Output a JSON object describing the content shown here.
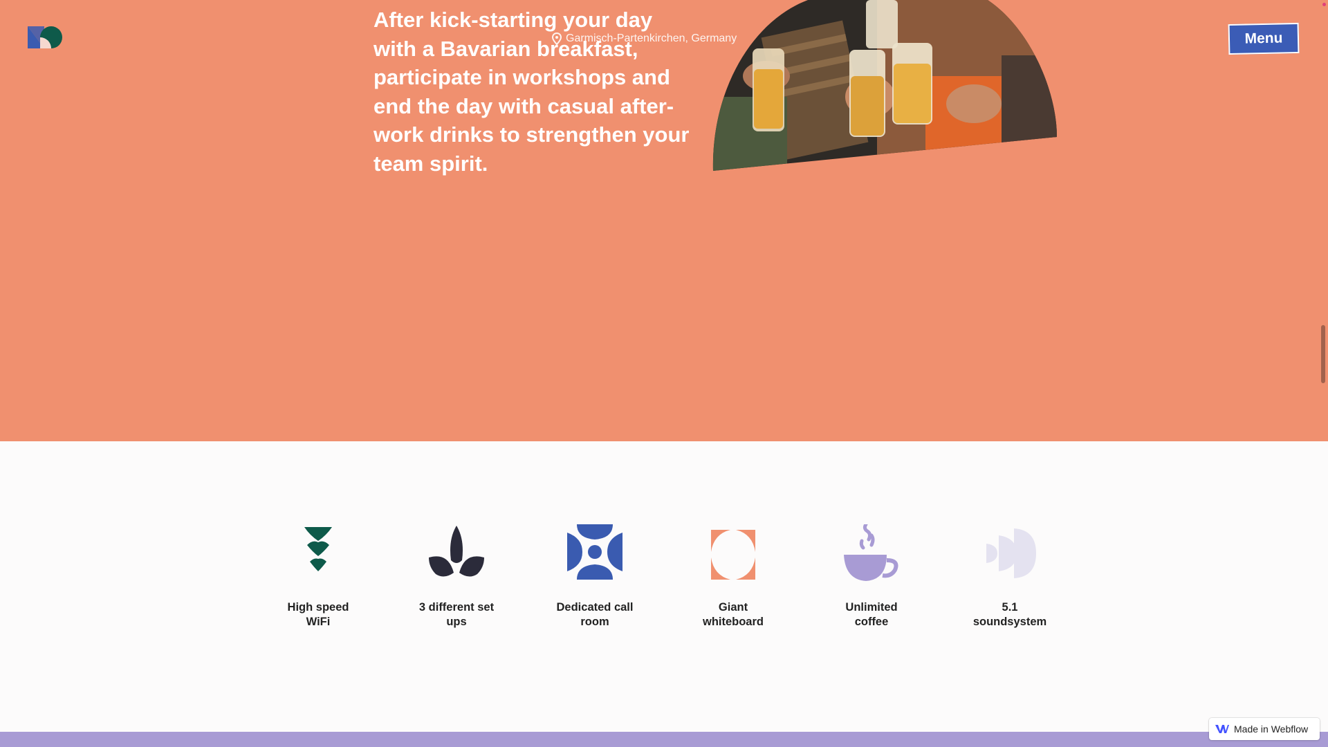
{
  "header": {
    "logo_icon": "brand-logo-icon",
    "menu_label": "Menu"
  },
  "hero": {
    "text": "After kick-starting your day with a Bavarian breakfast, participate in workshops and end the day with casual after-work drinks to strengthen your team spirit.",
    "location": "Garmisch-Partenkirchen, Germany",
    "location_icon": "map-pin-icon",
    "background_color": "#f0906f"
  },
  "amenities": [
    {
      "label": "High speed WiFi",
      "icon": "wifi-icon",
      "color": "#0e5a4a"
    },
    {
      "label": "3 different set ups",
      "icon": "leaf-icon",
      "color": "#2b2b3a"
    },
    {
      "label": "Dedicated call room",
      "icon": "call-room-icon",
      "color": "#3a5bb0"
    },
    {
      "label": "Giant whiteboard",
      "icon": "whiteboard-icon",
      "color": "#f0906f"
    },
    {
      "label": "Unlimited coffee",
      "icon": "coffee-icon",
      "color": "#a89bd4"
    },
    {
      "label": "5.1 soundsystem",
      "icon": "speaker-icon",
      "color": "#e4e2f0"
    }
  ],
  "badge": {
    "label": "Made in Webflow",
    "icon": "webflow-icon"
  }
}
